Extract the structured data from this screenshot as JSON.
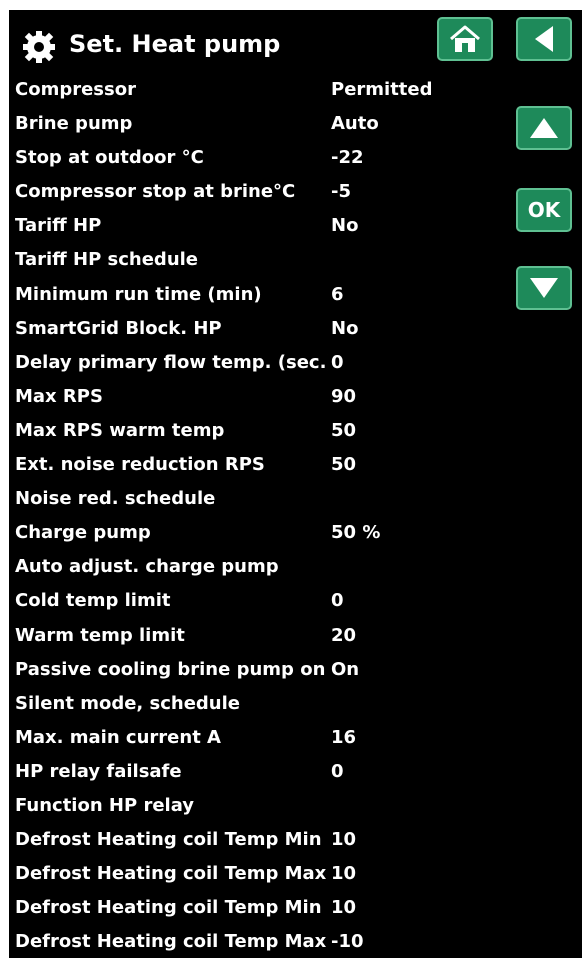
{
  "header": {
    "title": "Set. Heat pump",
    "icon": "gear-icon"
  },
  "nav": {
    "home_icon": "home-icon",
    "back_icon": "back-arrow-icon",
    "up_icon": "up-arrow-icon",
    "ok_label": "OK",
    "down_icon": "down-arrow-icon"
  },
  "colors": {
    "background": "#000000",
    "text": "#ffffff",
    "button_fill": "#1e8a5a",
    "button_border": "#5fc092"
  },
  "settings": [
    {
      "label": "Compressor",
      "value": "Permitted"
    },
    {
      "label": "Brine pump",
      "value": "Auto"
    },
    {
      "label": "Stop at outdoor °C",
      "value": "-22"
    },
    {
      "label": "Compressor stop at brine°C",
      "value": "-5"
    },
    {
      "label": "Tariff HP",
      "value": "No"
    },
    {
      "label": "Tariff HP schedule",
      "value": ""
    },
    {
      "label": "Minimum run time (min)",
      "value": "6"
    },
    {
      "label": "SmartGrid Block. HP",
      "value": "No"
    },
    {
      "label": "Delay primary flow temp. (sec.)",
      "value": "0"
    },
    {
      "label": "Max RPS",
      "value": "90"
    },
    {
      "label": "Max RPS warm temp",
      "value": "50"
    },
    {
      "label": "Ext. noise reduction RPS",
      "value": "50"
    },
    {
      "label": "Noise red. schedule",
      "value": ""
    },
    {
      "label": "Charge pump",
      "value": "50 %"
    },
    {
      "label": "Auto adjust. charge pump",
      "value": ""
    },
    {
      "label": "Cold temp limit",
      "value": "0"
    },
    {
      "label": "Warm temp limit",
      "value": "20"
    },
    {
      "label": "Passive cooling brine pump on",
      "value": "On"
    },
    {
      "label": "Silent mode, schedule",
      "value": ""
    },
    {
      "label": "Max. main current A",
      "value": "16"
    },
    {
      "label": "HP relay failsafe",
      "value": "0"
    },
    {
      "label": "Function HP relay",
      "value": ""
    },
    {
      "label": "Defrost Heating coil Temp Min m",
      "value": "10"
    },
    {
      "label": "Defrost Heating coil Temp Max m",
      "value": "10"
    },
    {
      "label": "Defrost Heating coil Temp Min °C",
      "value": "10"
    },
    {
      "label": "Defrost Heating coil Temp Max °C",
      "value": "-10"
    }
  ]
}
